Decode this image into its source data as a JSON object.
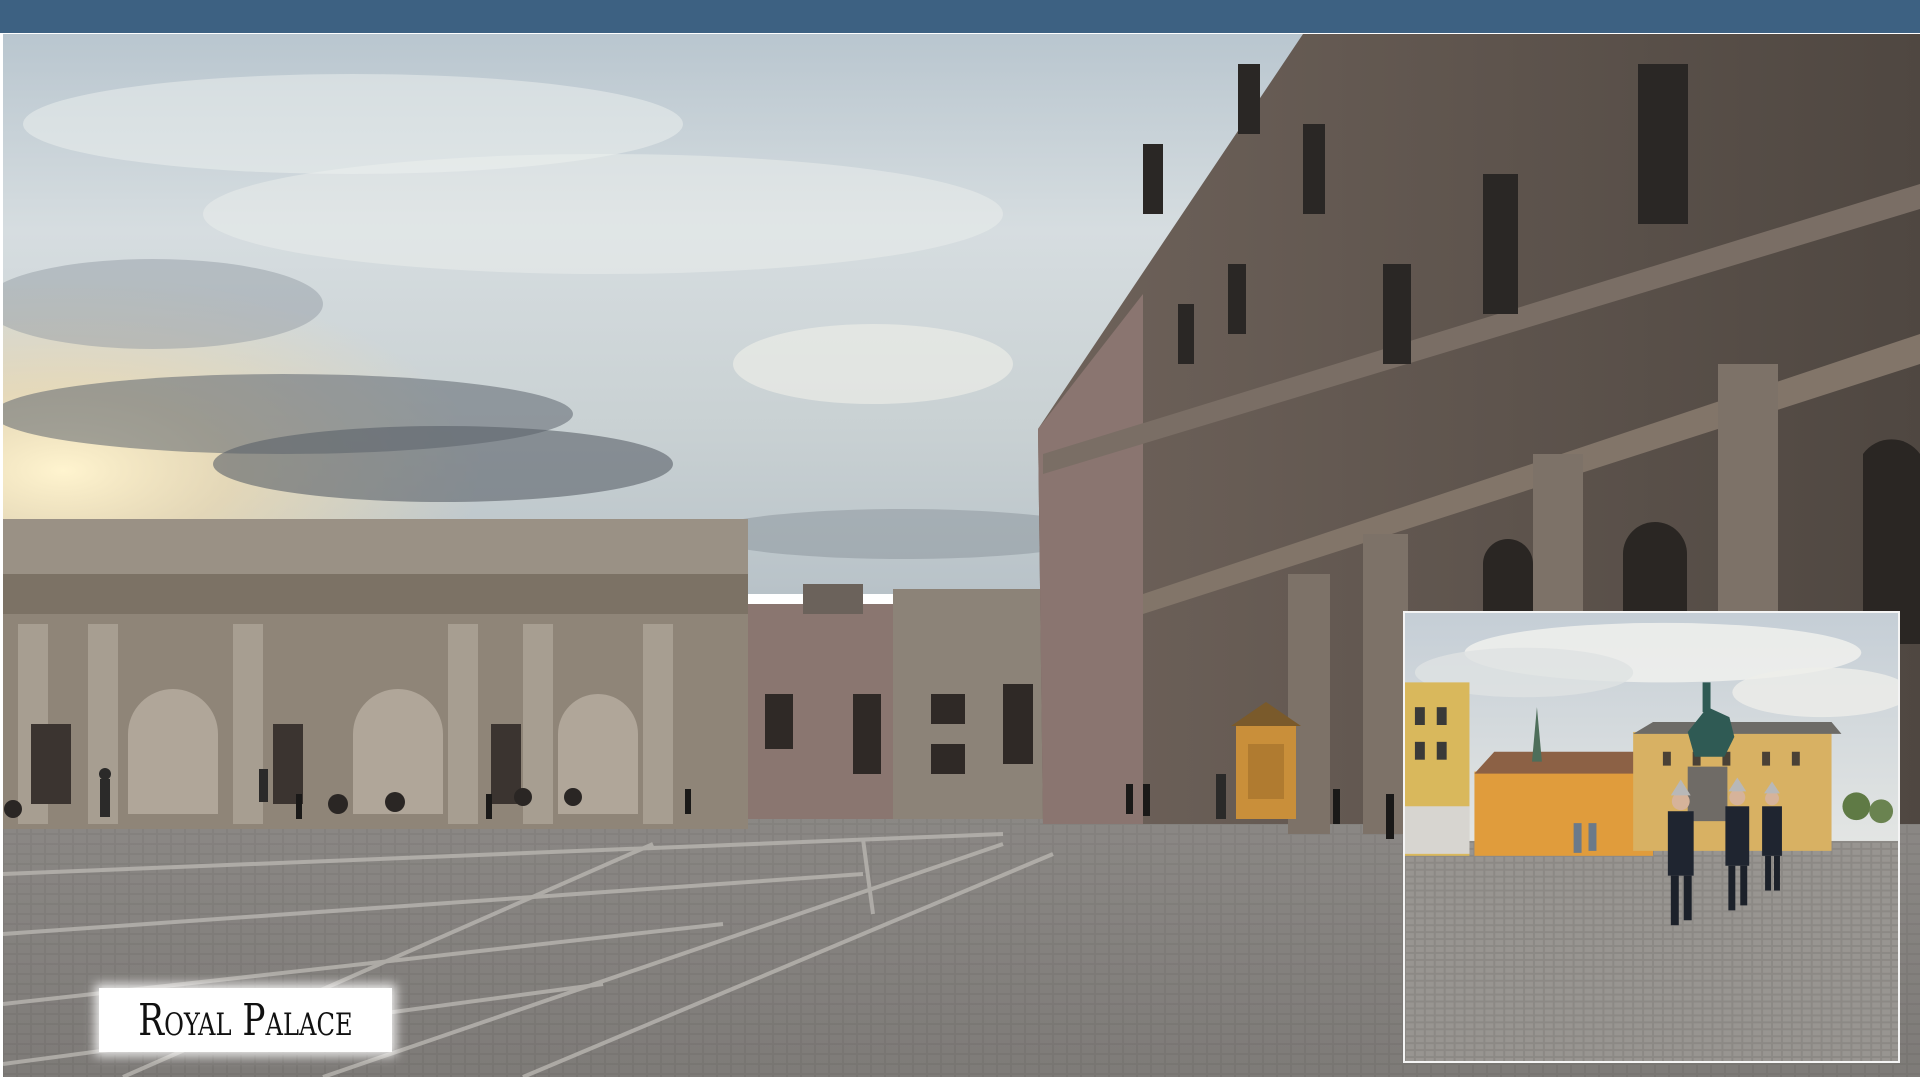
{
  "slide": {
    "header_bar_color": "#3d6182",
    "caption": "Royal Palace"
  },
  "main_photo": {
    "subject": "palace-courtyard-photo"
  },
  "inset_photo": {
    "subject": "guard-parade-photo"
  }
}
